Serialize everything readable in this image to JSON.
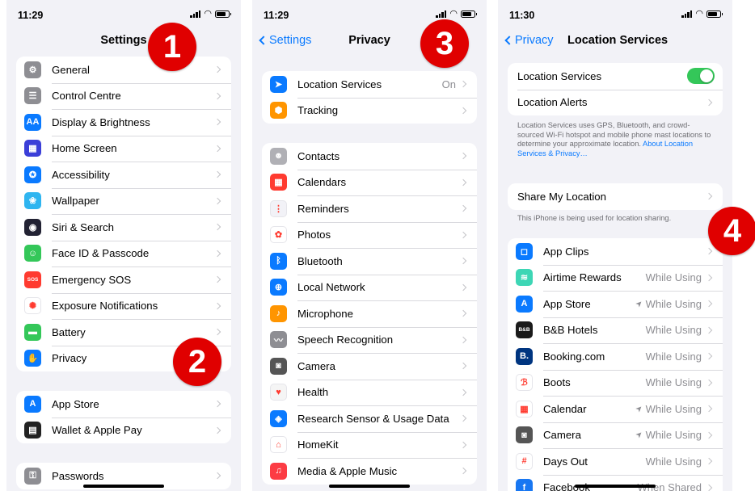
{
  "badges": [
    "1",
    "2",
    "3",
    "4"
  ],
  "screen1": {
    "time": "11:29",
    "title": "Settings",
    "group1": [
      {
        "label": "General",
        "icon": "gear-icon",
        "color": "#8e8e93",
        "glyph": "⚙"
      },
      {
        "label": "Control Centre",
        "icon": "toggles-icon",
        "color": "#8e8e93",
        "glyph": "☰"
      },
      {
        "label": "Display & Brightness",
        "icon": "text-size-icon",
        "color": "#0a7aff",
        "glyph": "AA"
      },
      {
        "label": "Home Screen",
        "icon": "grid-icon",
        "color": "#3b3fd8",
        "glyph": "▦"
      },
      {
        "label": "Accessibility",
        "icon": "accessibility-icon",
        "color": "#0a7aff",
        "glyph": "✪"
      },
      {
        "label": "Wallpaper",
        "icon": "flower-icon",
        "color": "#2fb5f0",
        "glyph": "❀"
      },
      {
        "label": "Siri & Search",
        "icon": "siri-icon",
        "color": "#222233",
        "glyph": "◉"
      },
      {
        "label": "Face ID & Passcode",
        "icon": "face-id-icon",
        "color": "#34c759",
        "glyph": "☺"
      },
      {
        "label": "Emergency SOS",
        "icon": "sos-icon",
        "color": "#ff3b30",
        "glyph": "SOS"
      },
      {
        "label": "Exposure Notifications",
        "icon": "exposure-icon",
        "color": "#ffffff",
        "glyph": "✺"
      },
      {
        "label": "Battery",
        "icon": "battery-icon",
        "color": "#34c759",
        "glyph": "▬"
      },
      {
        "label": "Privacy",
        "icon": "hand-icon",
        "color": "#0a7aff",
        "glyph": "✋"
      }
    ],
    "group2": [
      {
        "label": "App Store",
        "icon": "app-store-icon",
        "color": "#0a7aff",
        "glyph": "A"
      },
      {
        "label": "Wallet & Apple Pay",
        "icon": "wallet-icon",
        "color": "#222222",
        "glyph": "▤"
      }
    ],
    "group3": [
      {
        "label": "Passwords",
        "icon": "key-icon",
        "color": "#8e8e93",
        "glyph": "⚿"
      }
    ]
  },
  "screen2": {
    "time": "11:29",
    "back": "Settings",
    "title": "Privacy",
    "group1": [
      {
        "label": "Location Services",
        "value": "On",
        "icon": "location-arrow-icon",
        "color": "#0a7aff",
        "glyph": "➤"
      },
      {
        "label": "Tracking",
        "value": "",
        "icon": "tracking-icon",
        "color": "#ff9500",
        "glyph": "⬢"
      }
    ],
    "group2": [
      {
        "label": "Contacts",
        "icon": "contacts-icon",
        "color": "#b0b0b5",
        "glyph": "☻"
      },
      {
        "label": "Calendars",
        "icon": "calendar-icon",
        "color": "#ff3b30",
        "glyph": "▦"
      },
      {
        "label": "Reminders",
        "icon": "reminders-icon",
        "color": "#f2f2f7",
        "glyph": "⋮"
      },
      {
        "label": "Photos",
        "icon": "photos-icon",
        "color": "#ffffff",
        "glyph": "✿"
      },
      {
        "label": "Bluetooth",
        "icon": "bluetooth-icon",
        "color": "#0a7aff",
        "glyph": "ᛒ"
      },
      {
        "label": "Local Network",
        "icon": "globe-icon",
        "color": "#0a7aff",
        "glyph": "⊕"
      },
      {
        "label": "Microphone",
        "icon": "microphone-icon",
        "color": "#ff9500",
        "glyph": "♪"
      },
      {
        "label": "Speech Recognition",
        "icon": "waveform-icon",
        "color": "#8e8e93",
        "glyph": "〰"
      },
      {
        "label": "Camera",
        "icon": "camera-icon",
        "color": "#555555",
        "glyph": "◙"
      },
      {
        "label": "Health",
        "icon": "heart-icon",
        "color": "#f5f5f5",
        "glyph": "♥"
      },
      {
        "label": "Research Sensor & Usage Data",
        "icon": "research-icon",
        "color": "#0a7aff",
        "glyph": "◈"
      },
      {
        "label": "HomeKit",
        "icon": "home-icon",
        "color": "#ffffff",
        "glyph": "⌂"
      },
      {
        "label": "Media & Apple Music",
        "icon": "music-icon",
        "color": "#fc3c44",
        "glyph": "♫"
      }
    ]
  },
  "screen3": {
    "time": "11:30",
    "back": "Privacy",
    "title": "Location Services",
    "group1": [
      {
        "label": "Location Services",
        "type": "toggle"
      },
      {
        "label": "Location Alerts",
        "type": "chevron"
      }
    ],
    "note1": "Location Services uses GPS, Bluetooth, and crowd-sourced Wi-Fi hotspot and mobile phone mast locations to determine your approximate location.",
    "note1_link": "About Location Services & Privacy…",
    "share_label": "Share My Location",
    "note2": "This iPhone is being used for location sharing.",
    "apps": [
      {
        "label": "App Clips",
        "value": "",
        "arrow": false,
        "icon": "app-clips-icon",
        "color": "#0a7aff",
        "glyph": "◻"
      },
      {
        "label": "Airtime Rewards",
        "value": "While Using",
        "arrow": false,
        "icon": "airtime-icon",
        "color": "#3dd6b5",
        "glyph": "≋"
      },
      {
        "label": "App Store",
        "value": "While Using",
        "arrow": true,
        "icon": "app-store-icon",
        "color": "#0a7aff",
        "glyph": "A"
      },
      {
        "label": "B&B Hotels",
        "value": "While Using",
        "arrow": false,
        "icon": "bb-hotels-icon",
        "color": "#1a1a1a",
        "glyph": "B&B"
      },
      {
        "label": "Booking.com",
        "value": "While Using",
        "arrow": false,
        "icon": "booking-icon",
        "color": "#003580",
        "glyph": "B."
      },
      {
        "label": "Boots",
        "value": "While Using",
        "arrow": false,
        "icon": "boots-icon",
        "color": "#ffffff",
        "glyph": "ℬ"
      },
      {
        "label": "Calendar",
        "value": "While Using",
        "arrow": true,
        "icon": "calendar-icon",
        "color": "#ffffff",
        "glyph": "▦"
      },
      {
        "label": "Camera",
        "value": "While Using",
        "arrow": true,
        "icon": "camera-icon",
        "color": "#555555",
        "glyph": "◙"
      },
      {
        "label": "Days Out",
        "value": "While Using",
        "arrow": false,
        "icon": "days-out-icon",
        "color": "#ffffff",
        "glyph": "#"
      },
      {
        "label": "Facebook",
        "value": "When Shared",
        "arrow": false,
        "icon": "facebook-icon",
        "color": "#1877f2",
        "glyph": "f"
      }
    ]
  }
}
